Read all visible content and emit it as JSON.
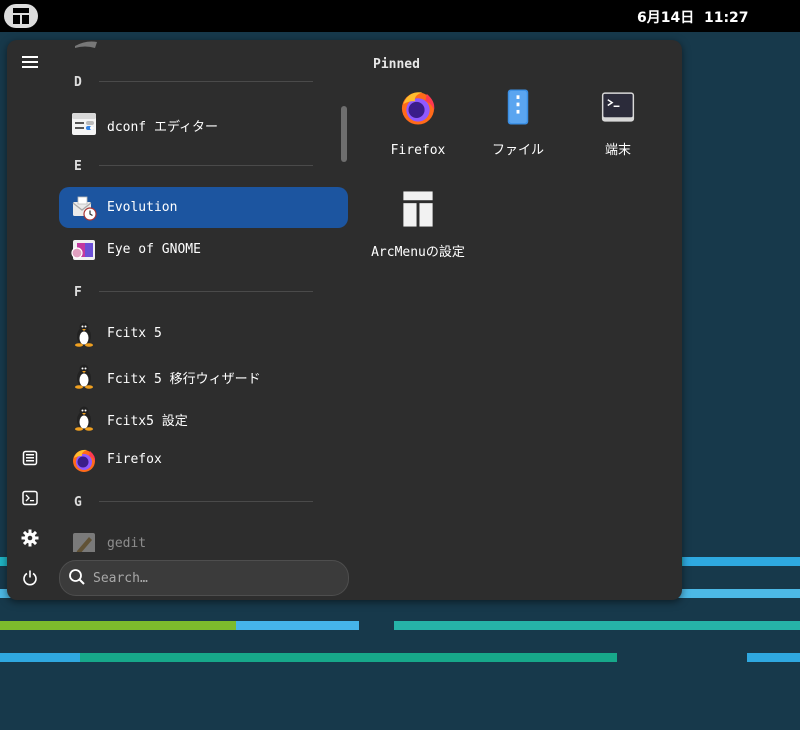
{
  "topbar": {
    "clock": "6月14日  11:27"
  },
  "sidebar": {
    "items": [
      {
        "icon": "hamburger-icon"
      },
      {
        "icon": "document-icon"
      },
      {
        "icon": "terminal-icon"
      },
      {
        "icon": "gear-icon"
      },
      {
        "icon": "power-icon"
      }
    ]
  },
  "applist": {
    "headers": [
      "D",
      "E",
      "F",
      "G"
    ],
    "apps": [
      {
        "label": "dconf エディター",
        "icon": "dconf-icon"
      },
      {
        "label": "Evolution",
        "icon": "evolution-icon",
        "selected": true
      },
      {
        "label": "Eye of GNOME",
        "icon": "eog-icon"
      },
      {
        "label": "Fcitx 5",
        "icon": "penguin-icon"
      },
      {
        "label": "Fcitx 5 移行ウィザード",
        "icon": "penguin-icon"
      },
      {
        "label": "Fcitx5 設定",
        "icon": "penguin-icon"
      },
      {
        "label": "Firefox",
        "icon": "firefox-icon"
      },
      {
        "label": "gedit",
        "icon": "gedit-icon"
      }
    ]
  },
  "search": {
    "placeholder": "Search…"
  },
  "pinned": {
    "title": "Pinned",
    "tiles": [
      {
        "label": "Firefox",
        "icon": "firefox-icon"
      },
      {
        "label": "ファイル",
        "icon": "files-icon"
      },
      {
        "label": "端末",
        "icon": "terminal-icon"
      },
      {
        "label": "ArcMenuの設定",
        "icon": "arcmenu-settings-icon"
      }
    ]
  },
  "colors": {
    "selected": "#1c55a0",
    "menu_bg": "#2d2d2d",
    "wallpaper": "#17394b"
  }
}
